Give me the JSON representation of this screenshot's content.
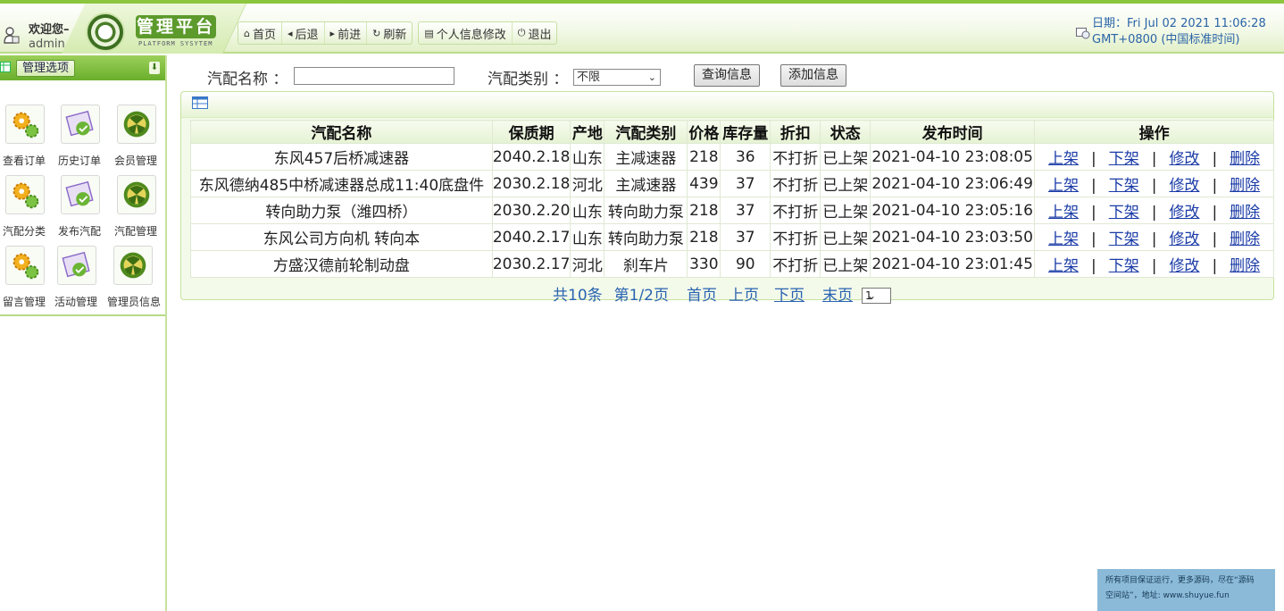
{
  "header": {
    "welcome": "欢迎您–",
    "username": "admin",
    "logo_title": "管理平台",
    "logo_subtitle": "PLATFORM SYSYTEM",
    "nav": [
      "首页",
      "后退",
      "前进",
      "刷新"
    ],
    "nav2": [
      "个人信息修改",
      "退出"
    ],
    "date_line1": "日期：Fri Jul 02 2021 11:06:28",
    "date_line2": "GMT+0800 (中国标准时间)"
  },
  "sidebar": {
    "title": "管理选项",
    "items": [
      "查看订单",
      "历史订单",
      "会员管理",
      "汽配分类",
      "发布汽配",
      "汽配管理",
      "留言管理",
      "活动管理",
      "管理员信息"
    ]
  },
  "search": {
    "name_label": "汽配名称 ：",
    "name_value": "",
    "type_label": "汽配类别 ：",
    "type_selected": "不限",
    "query_button": "查询信息",
    "add_button": "添加信息"
  },
  "table": {
    "headers": [
      "汽配名称",
      "保质期",
      "产地",
      "汽配类别",
      "价格",
      "库存量",
      "折扣",
      "状态",
      "发布时间",
      "操作"
    ],
    "rows": [
      [
        "东风457后桥减速器",
        "2040.2.18",
        "山东",
        "主减速器",
        "218",
        "36",
        "不打折",
        "已上架",
        "2021-04-10 23:08:05"
      ],
      [
        "东风德纳485中桥减速器总成11:40底盘件",
        "2030.2.18",
        "河北",
        "主减速器",
        "439",
        "37",
        "不打折",
        "已上架",
        "2021-04-10 23:06:49"
      ],
      [
        "转向助力泵（潍四桥）",
        "2030.2.20",
        "山东",
        "转向助力泵",
        "218",
        "37",
        "不打折",
        "已上架",
        "2021-04-10 23:05:16"
      ],
      [
        "东风公司方向机 转向本",
        "2040.2.17",
        "山东",
        "转向助力泵",
        "218",
        "37",
        "不打折",
        "已上架",
        "2021-04-10 23:03:50"
      ],
      [
        "方盛汉德前轮制动盘",
        "2030.2.17",
        "河北",
        "刹车片",
        "330",
        "90",
        "不打折",
        "已上架",
        "2021-04-10 23:01:45"
      ]
    ],
    "ops": [
      "上架",
      "下架",
      "修改",
      "删除"
    ],
    "sep": "|"
  },
  "pager": {
    "total": "共10条",
    "page": "第1/2页",
    "first": "首页",
    "prev": "上页",
    "next": "下页",
    "last": "末页",
    "selected": "1"
  },
  "watermark": {
    "line1": "所有项目保证运行，更多源码，尽在“源码",
    "line2": "空间站”，地址: www.shuyue.fun"
  }
}
